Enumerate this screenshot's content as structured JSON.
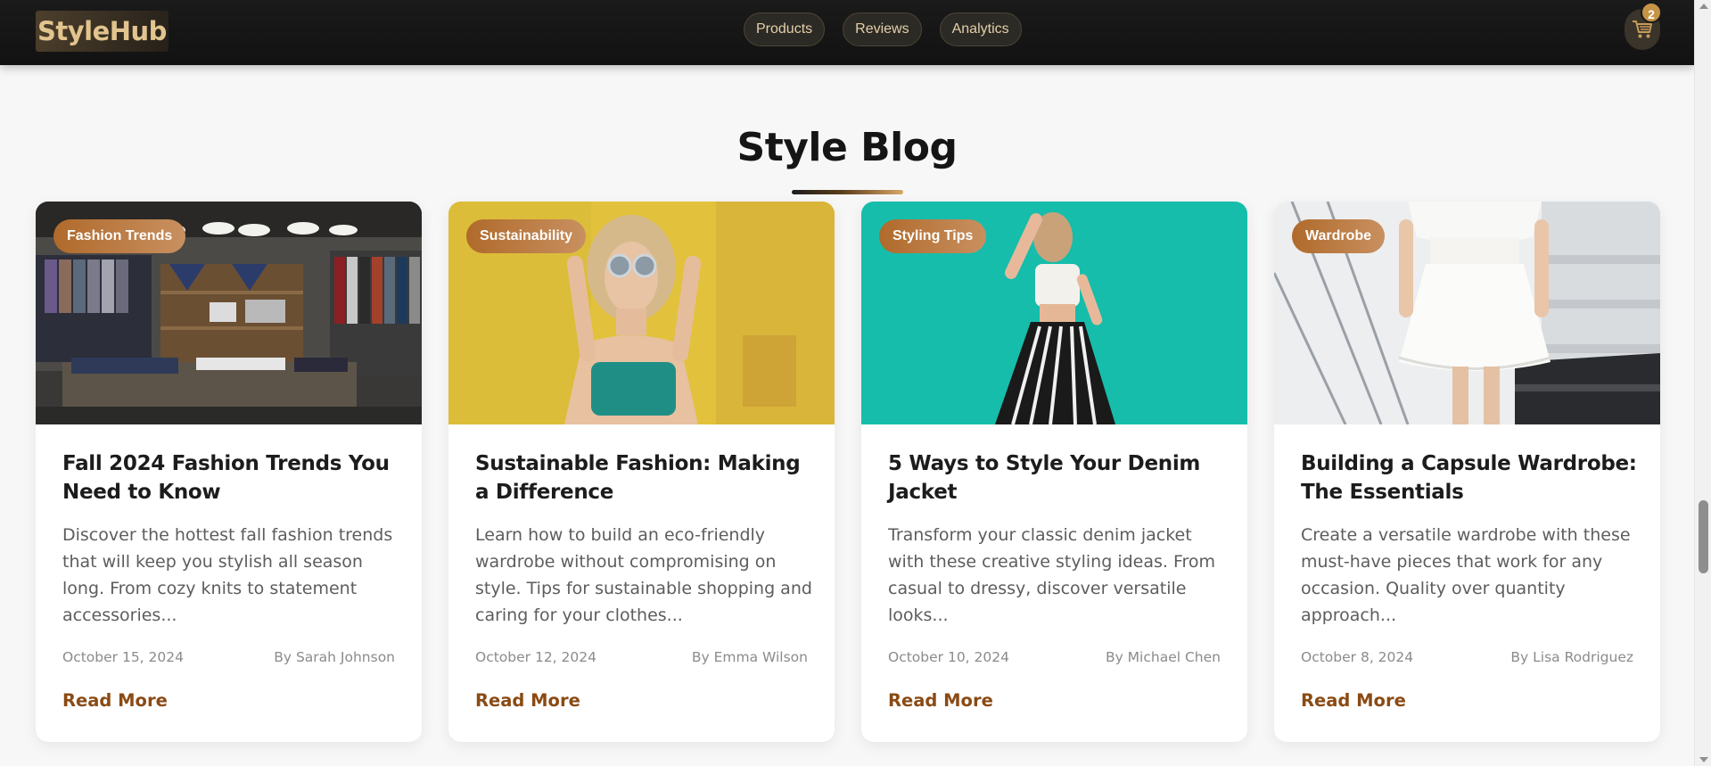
{
  "header": {
    "logo": "StyleHub",
    "nav": [
      {
        "label": "Products"
      },
      {
        "label": "Reviews"
      },
      {
        "label": "Analytics"
      }
    ],
    "cart": {
      "icon": "cart-icon",
      "count": "2"
    }
  },
  "section": {
    "title": "Style Blog"
  },
  "posts": [
    {
      "tag": "Fashion Trends",
      "title": "Fall 2024 Fashion Trends You Need to Know",
      "excerpt": "Discover the hottest fall fashion trends that will keep you stylish all season long. From cozy knits to statement accessories...",
      "date": "October 15, 2024",
      "author": "By Sarah Johnson",
      "cta": "Read More",
      "image": "clothing-store-shelves-photo"
    },
    {
      "tag": "Sustainability",
      "title": "Sustainable Fashion: Making a Difference",
      "excerpt": "Learn how to build an eco-friendly wardrobe without compromising on style. Tips for sustainable shopping and caring for your clothes...",
      "date": "October 12, 2024",
      "author": "By Emma Wilson",
      "cta": "Read More",
      "image": "woman-sunglasses-yellow-wall-photo"
    },
    {
      "tag": "Styling Tips",
      "title": "5 Ways to Style Your Denim Jacket",
      "excerpt": "Transform your classic denim jacket with these creative styling ideas. From casual to dressy, discover versatile looks...",
      "date": "October 10, 2024",
      "author": "By Michael Chen",
      "cta": "Read More",
      "image": "woman-striped-pants-teal-wall-photo"
    },
    {
      "tag": "Wardrobe",
      "title": "Building a Capsule Wardrobe: The Essentials",
      "excerpt": "Create a versatile wardrobe with these must-have pieces that work for any occasion. Quality over quantity approach...",
      "date": "October 8, 2024",
      "author": "By Lisa Rodriguez",
      "cta": "Read More",
      "image": "white-dress-staircase-photo"
    }
  ],
  "colors": {
    "accent": "#8a4a14",
    "tag_gradient_start": "#b06a2b",
    "tag_gradient_end": "#c89060",
    "header_bg": "#1a1a1a",
    "logo_gold": "#e2c48e"
  }
}
